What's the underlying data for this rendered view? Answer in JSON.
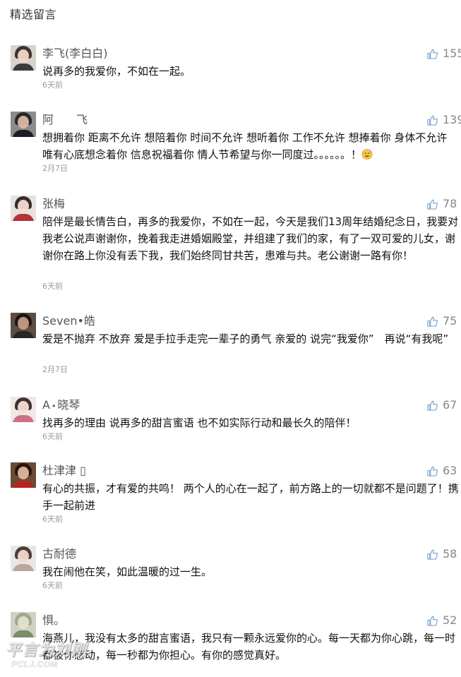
{
  "header": {
    "title": "精选留言"
  },
  "comments": [
    {
      "name": "李飞(李白白)",
      "text": "说再多的我爱你，不如在一起。",
      "time": "6天前",
      "likes": "155",
      "avatar": {
        "bg": "#d8d2cc",
        "hair": "#2b2220",
        "face": "#f1d6c8",
        "shoulders": "#3c3a3f"
      }
    },
    {
      "name": "阿　　飞",
      "text": "想拥着你 距离不允许 想陪着你 时间不允许 想听着你 工作不允许 想捧着你 身体不允许 唯有心底想念着你 信息祝福着你 情人节希望与你一同度过。。。。。。！",
      "time": "2月7日",
      "likes": "139",
      "avatar": {
        "bg": "#8c8c8c",
        "hair": "#1c1c1c",
        "face": "#d8b9a4",
        "shoulders": "#1a1d26"
      },
      "emoji": "sweat-smile-emoji"
    },
    {
      "name": "张梅",
      "text": "陪伴是最长情告白，再多的我爱你，不如在一起，今天是我们13周年结婚纪念日，我要对我老公说声谢谢你，挽着我走进婚姻殿堂，并组建了我们的家，有了一双可爱的儿女，谢谢你在路上你没有丢下我，我们始终同甘共苦，患难与共。老公谢谢一路有你！",
      "time": "6天前",
      "likes": "78",
      "avatar": {
        "bg": "#e7e2dd",
        "hair": "#231a17",
        "face": "#f3dcd0",
        "shoulders": "#b23437"
      }
    },
    {
      "name": "Seven•皓",
      "text": "爱是不抛弃 不放弃 爱是手拉手走完一辈子的勇气 亲爱的 说完“我爱你”　再说“有我呢”",
      "time": "2月7日",
      "likes": "75",
      "avatar": {
        "bg": "#5c4e44",
        "hair": "#16110e",
        "face": "#c69c82",
        "shoulders": "#2a2422"
      }
    },
    {
      "name": "A᭼晓琴",
      "text": "找再多的理由 说再多的甜言蜜语 也不如实际行动和最长久的陪伴！",
      "time": "6天前",
      "likes": "67",
      "avatar": {
        "bg": "#efe8e4",
        "hair": "#2a1d1b",
        "face": "#f4ddd4",
        "shoulders": "#cf6f83"
      }
    },
    {
      "name": "杜津津 ▯",
      "text": "有心的共振，才有爱的共鸣！ 两个人的心在一起了，前方路上的一切就都不是问题了！携手一起前进",
      "time": "6天前",
      "likes": "63",
      "avatar": {
        "bg": "#6b4b35",
        "hair": "#1f120c",
        "face": "#dfb89c",
        "shoulders": "#b5231f"
      }
    },
    {
      "name": "古耐德",
      "text": "我在闹他在笑，如此温暖的过一生。",
      "time": "6天前",
      "likes": "58",
      "avatar": {
        "bg": "#e9e6e3",
        "hair": "#3b2a25",
        "face": "#f2d9cd",
        "shoulders": "#b8a7a1"
      }
    },
    {
      "name": "惧。",
      "text": "海燕儿，我没有太多的甜言蜜语，我只有一颗永远爱你的心。每一天都为你心跳，每一时都被你感动，每一秒都为你担心。有你的感觉真好。",
      "time": "",
      "likes": "52",
      "avatar": {
        "bg": "#cfd2c2",
        "hair": "#9aa38a",
        "face": "#e6e2cc",
        "shoulders": "#7d8a6c"
      }
    }
  ],
  "icons": {
    "like": "thumbs-up-icon"
  },
  "colors": {
    "name": "#555555",
    "text": "#111111",
    "time": "#999999",
    "like": "#888888"
  },
  "watermark": {
    "main": "平言为刘刚",
    "sub": "PCLJ.COM"
  }
}
